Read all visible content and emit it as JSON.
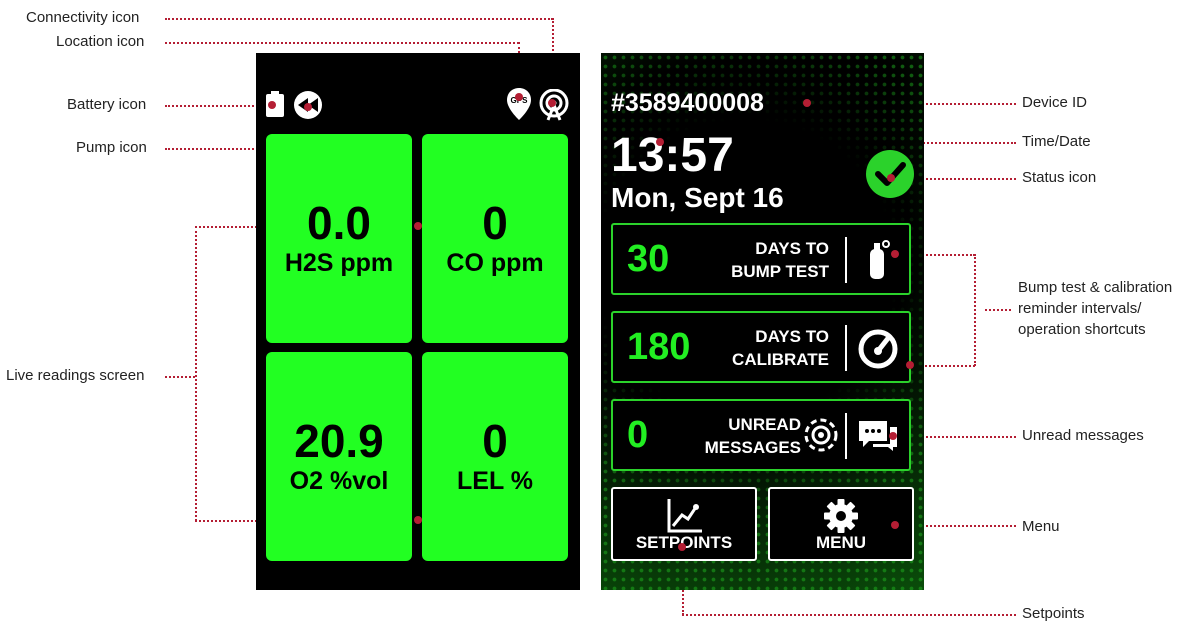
{
  "callouts": {
    "connectivity": "Connectivity icon",
    "location": "Location icon",
    "battery": "Battery icon",
    "pump": "Pump icon",
    "live": "Live readings screen",
    "device_id": "Device ID",
    "time_date": "Time/Date",
    "status": "Status icon",
    "bump_line1": "Bump test & calibration",
    "bump_line2": "reminder intervals/",
    "bump_line3": "operation shortcuts",
    "unread": "Unread messages",
    "menu": "Menu",
    "setpoints": "Setpoints"
  },
  "left_screen": {
    "gps_label": "GPS",
    "readings": [
      {
        "value": "0.0",
        "unit": "H2S ppm"
      },
      {
        "value": "0",
        "unit": "CO ppm"
      },
      {
        "value": "20.9",
        "unit": "O2 %vol"
      },
      {
        "value": "0",
        "unit": "LEL %"
      }
    ]
  },
  "right_screen": {
    "device_id": "#3589400008",
    "time": "13:57",
    "date": "Mon, Sept 16",
    "bump": {
      "value": "30",
      "label1": "DAYS TO",
      "label2": "BUMP TEST"
    },
    "calibrate": {
      "value": "180",
      "label1": "DAYS TO",
      "label2": "CALIBRATE"
    },
    "messages": {
      "value": "0",
      "label1": "UNREAD",
      "label2": "MESSAGES"
    },
    "setpoints_label": "SETPOINTS",
    "menu_label": "MENU"
  },
  "colors": {
    "tile_green": "#22ff22",
    "accent_green": "#22ee22",
    "callout_red": "#b41e34"
  },
  "icons": [
    "battery-icon",
    "pump-icon",
    "gps-location-icon",
    "connectivity-icon",
    "status-check-icon",
    "gas-cylinder-icon",
    "gauge-icon",
    "radar-icon",
    "chat-icon",
    "chart-line-icon",
    "gear-icon"
  ]
}
